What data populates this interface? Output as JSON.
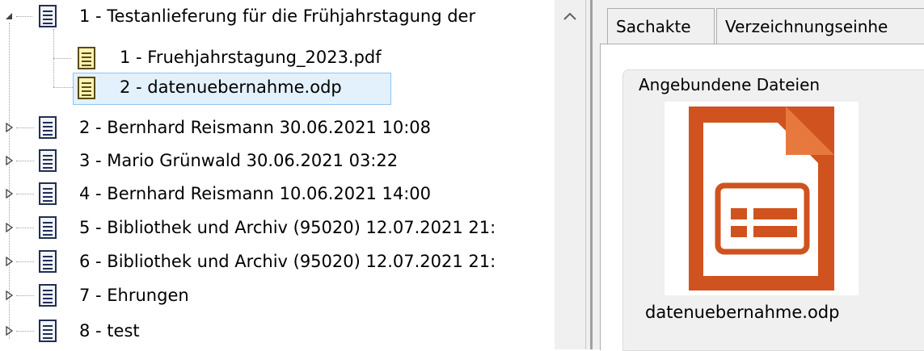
{
  "tree": {
    "root": {
      "label": "1 - Testanlieferung für die Frühjahrstagung der",
      "expanded": true
    },
    "children": [
      {
        "label": "1 - Fruehjahrstagung_2023.pdf",
        "selected": false
      },
      {
        "label": "2 - datenuebernahme.odp",
        "selected": true
      }
    ],
    "items": [
      {
        "label": "2 - Bernhard Reismann 30.06.2021 10:08"
      },
      {
        "label": "3 - Mario Grünwald 30.06.2021 03:22"
      },
      {
        "label": "4 - Bernhard Reismann 10.06.2021 14:00"
      },
      {
        "label": "5 - Bibliothek und Archiv (95020) 12.07.2021 21:"
      },
      {
        "label": "6 - Bibliothek und Archiv (95020) 12.07.2021 21:"
      },
      {
        "label": "7 - Ehrungen"
      },
      {
        "label": "8 - test"
      }
    ]
  },
  "tabs": [
    {
      "label": "Sachakte"
    },
    {
      "label": "Verzeichnungseinhe"
    }
  ],
  "attachments": {
    "title": "Angebundene Dateien",
    "file": {
      "name": "datenuebernahme.odp",
      "icon": "libreoffice-impress-icon"
    }
  },
  "colors": {
    "selection_bg": "#e3f1fc",
    "selection_border": "#90c4f0",
    "impress_orange": "#d0531f"
  }
}
